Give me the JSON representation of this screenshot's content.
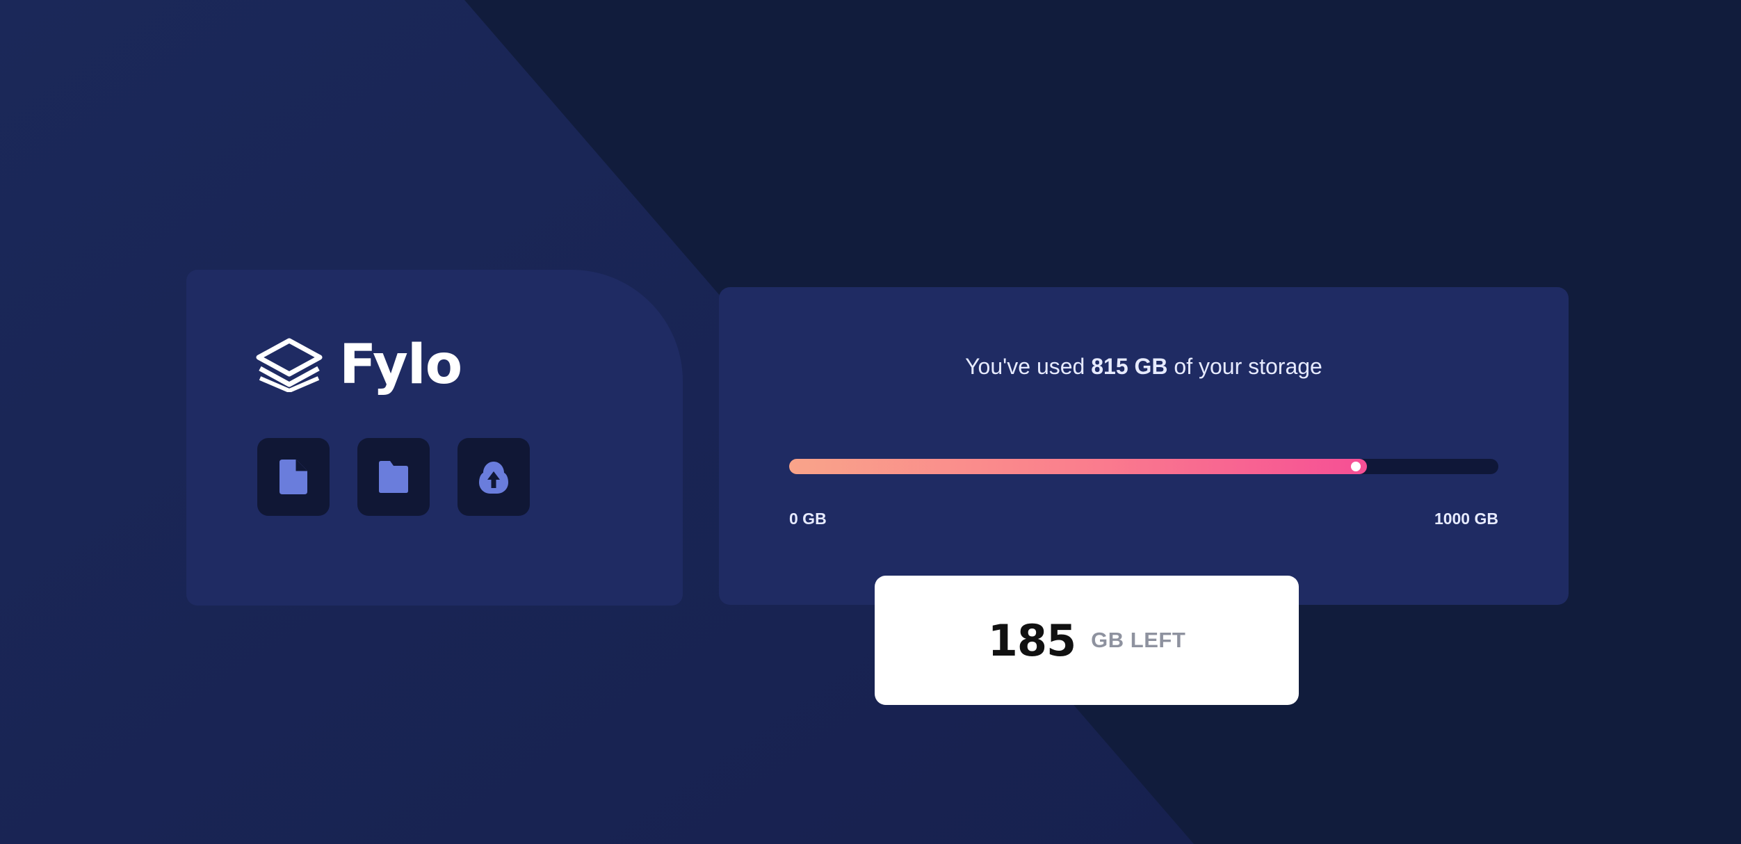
{
  "brand": {
    "name": "Fylo",
    "logo_icon": "layers-icon"
  },
  "toolbar": {
    "buttons": [
      {
        "icon": "document-icon"
      },
      {
        "icon": "folder-icon"
      },
      {
        "icon": "upload-icon"
      }
    ]
  },
  "storage": {
    "used_prefix": "You've used ",
    "used_amount": "815 GB",
    "used_suffix": " of your storage",
    "min_label": "0 GB",
    "max_label": "1000 GB",
    "used_fraction": 0.815,
    "remaining_value": "185",
    "remaining_unit": "GB LEFT"
  },
  "colors": {
    "page_background": "#111c3c",
    "card_background": "#1f2b63",
    "icon_tile": "#101735",
    "icon_accent": "#6a7ddc",
    "meter_gradient_start": "#f9a48a",
    "meter_gradient_end": "#f64f95"
  }
}
